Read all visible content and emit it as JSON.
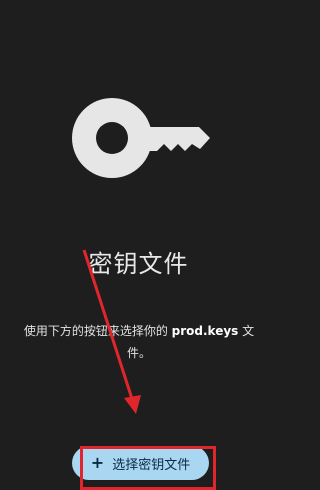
{
  "screen": {
    "title": "密钥文件",
    "description_prefix": "使用下方的按钮来选择你的 ",
    "description_highlight": "prod.keys",
    "description_suffix": " 文件。"
  },
  "icon": {
    "name": "key-icon"
  },
  "action": {
    "select_button_label": "选择密钥文件",
    "select_button_icon": "+"
  },
  "colors": {
    "background": "#1e1e1e",
    "button": "#a9d6f0",
    "annotation": "#e0262c"
  }
}
